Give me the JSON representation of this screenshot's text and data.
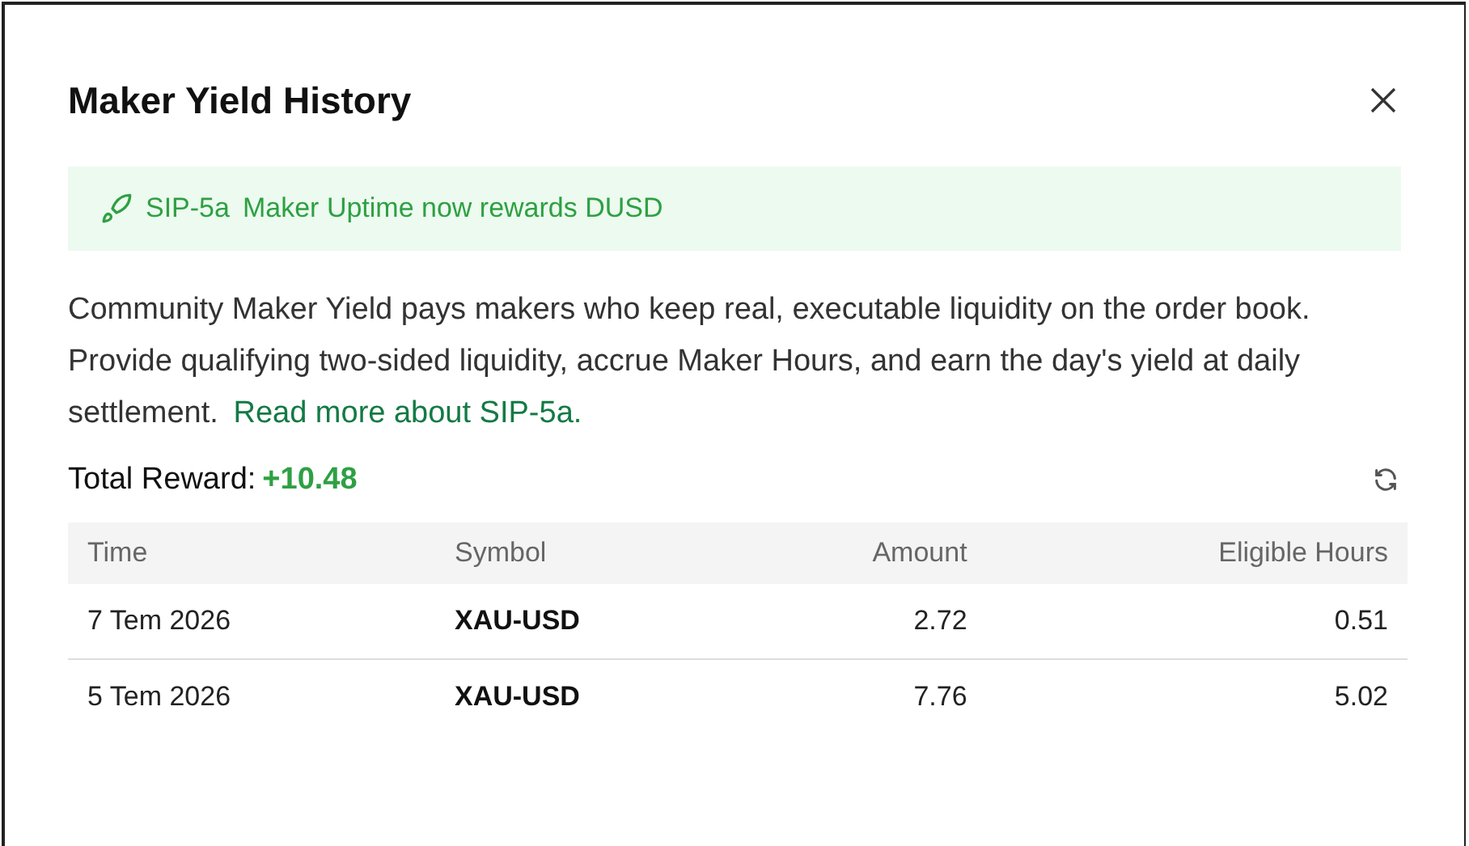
{
  "dialog": {
    "title": "Maker Yield History"
  },
  "banner": {
    "tag": "SIP-5a",
    "text": "Maker Uptime now rewards DUSD"
  },
  "description": {
    "text": "Community Maker Yield pays makers who keep real, executable liquidity on the order book. Provide qualifying two-sided liquidity, accrue Maker Hours, and earn the day's yield at daily settlement.",
    "link": "Read more about SIP-5a."
  },
  "total": {
    "label": "Total Reward:",
    "value": "+10.48"
  },
  "table": {
    "columns": [
      "Time",
      "Symbol",
      "Amount",
      "Eligible Hours"
    ],
    "rows": [
      [
        "7 Tem 2026",
        "XAU-USD",
        "2.72",
        "0.51"
      ],
      [
        "5 Tem 2026",
        "XAU-USD",
        "7.76",
        "5.02"
      ]
    ]
  }
}
